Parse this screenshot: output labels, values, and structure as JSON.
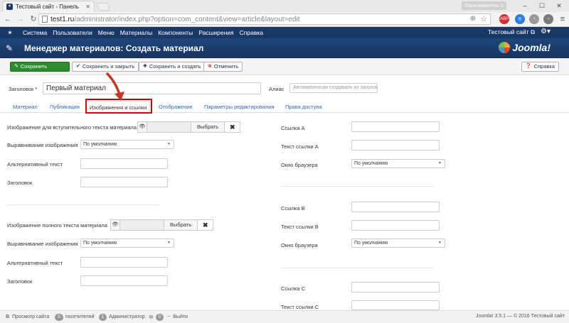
{
  "browser": {
    "tab_title": "Тестовый сайт - Панель",
    "user_label": "Пользователь 1",
    "url_host": "test1.ru",
    "url_path": "/administrator/index.php?option=com_content&view=article&layout=edit"
  },
  "topnav": {
    "items": [
      "Система",
      "Пользователи",
      "Меню",
      "Материалы",
      "Компоненты",
      "Расширения",
      "Справка"
    ],
    "site_link": "Тестовый сайт"
  },
  "header": {
    "title": "Менеджер материалов: Создать материал",
    "brand": "Joomla!"
  },
  "toolbar": {
    "save": "Сохранить",
    "save_close": "Сохранить и закрыть",
    "save_new": "Сохранить и создать",
    "cancel": "Отменить",
    "help": "Справка"
  },
  "form": {
    "title_label": "Заголовок *",
    "title_value": "Первый материал",
    "alias_label": "Алиас",
    "alias_placeholder": "Автоматически создавать из заголовка"
  },
  "tabs": [
    "Материал",
    "Публикация",
    "Изображения и ссылки",
    "Отображение",
    "Параметры редактирования",
    "Права доступа"
  ],
  "intro_image": {
    "label": "Изображение для вступительного текста материала",
    "choose": "Выбрать",
    "align_label": "Выравнивание изображения",
    "align_value": "По умолчанию",
    "alt_label": "Альтернативный текст",
    "caption_label": "Заголовок"
  },
  "full_image": {
    "label": "Изображение полного текста материала",
    "choose": "Выбрать",
    "align_label": "Выравнивание изображения",
    "align_value": "По умолчанию",
    "alt_label": "Альтернативный текст",
    "caption_label": "Заголовок"
  },
  "links": {
    "a_label": "Ссылка A",
    "a_text_label": "Текст ссылки A",
    "a_window_label": "Окно браузера",
    "a_window_value": "По умолчанию",
    "b_label": "Ссылка B",
    "b_text_label": "Текст ссылки B",
    "b_window_label": "Окно браузера",
    "b_window_value": "По умолчанию",
    "c_label": "Ссылка C",
    "c_text_label": "Текст ссылки C"
  },
  "status": {
    "view_site": "Просмотр сайта",
    "visitors_count": "0",
    "visitors_label": "посетителей",
    "admins_count": "1",
    "admins_label": "Администратор",
    "messages_count": "0",
    "logout": "Выйти",
    "copyright": "Joomla! 3.5.1 — © 2016 Тестовый сайт"
  },
  "colors": {
    "nav_bg": "#1a3867",
    "save_green": "#2f8b2f",
    "highlight_red": "#cc0000",
    "link_blue": "#2a69b8"
  }
}
